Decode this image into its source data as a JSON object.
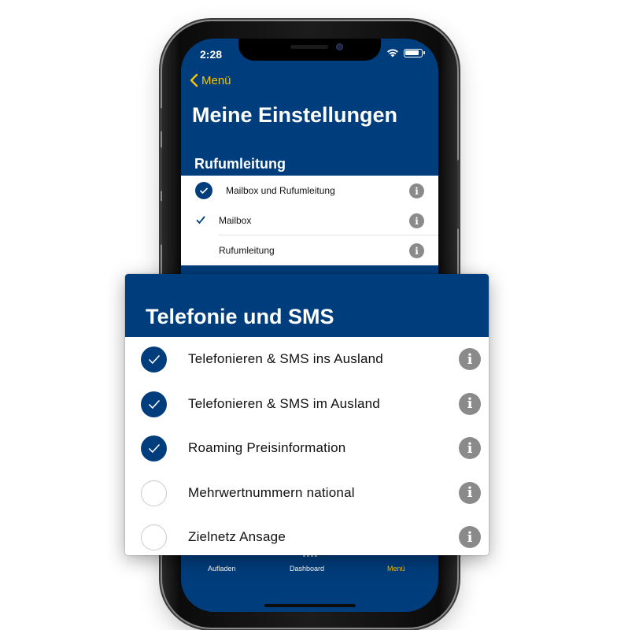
{
  "status": {
    "time": "2:28"
  },
  "nav": {
    "back_label": "Menü"
  },
  "page": {
    "title": "Meine Einstellungen"
  },
  "rufumleitung": {
    "title": "Rufumleitung",
    "items": [
      {
        "label": "Mailbox und Rufumleitung",
        "checked": true,
        "style": "circle"
      },
      {
        "label": "Mailbox",
        "checked": true,
        "style": "plain"
      },
      {
        "label": "Rufumleitung",
        "checked": false,
        "style": "none"
      }
    ]
  },
  "telefonie": {
    "title": "Telefonie und SMS",
    "items": [
      {
        "label": "Telefonieren & SMS ins Ausland",
        "checked": true
      },
      {
        "label": "Telefonieren & SMS im Ausland",
        "checked": true
      },
      {
        "label": "Roaming Preisinformation",
        "checked": true
      },
      {
        "label": "Mehrwertnummern national",
        "checked": false
      },
      {
        "label": "Zielnetz Ansage",
        "checked": false
      }
    ]
  },
  "tabs": [
    {
      "label": "Aufladen",
      "icon": "top-up-icon"
    },
    {
      "label": "Dashboard",
      "icon": "dashboard-icon"
    },
    {
      "label": "Menü",
      "icon": "menu-icon",
      "active": true
    }
  ],
  "info_glyph": "i",
  "colors": {
    "brand_blue": "#003d7c",
    "accent_yellow": "#f5c400",
    "info_gray": "#8a8a8a"
  }
}
